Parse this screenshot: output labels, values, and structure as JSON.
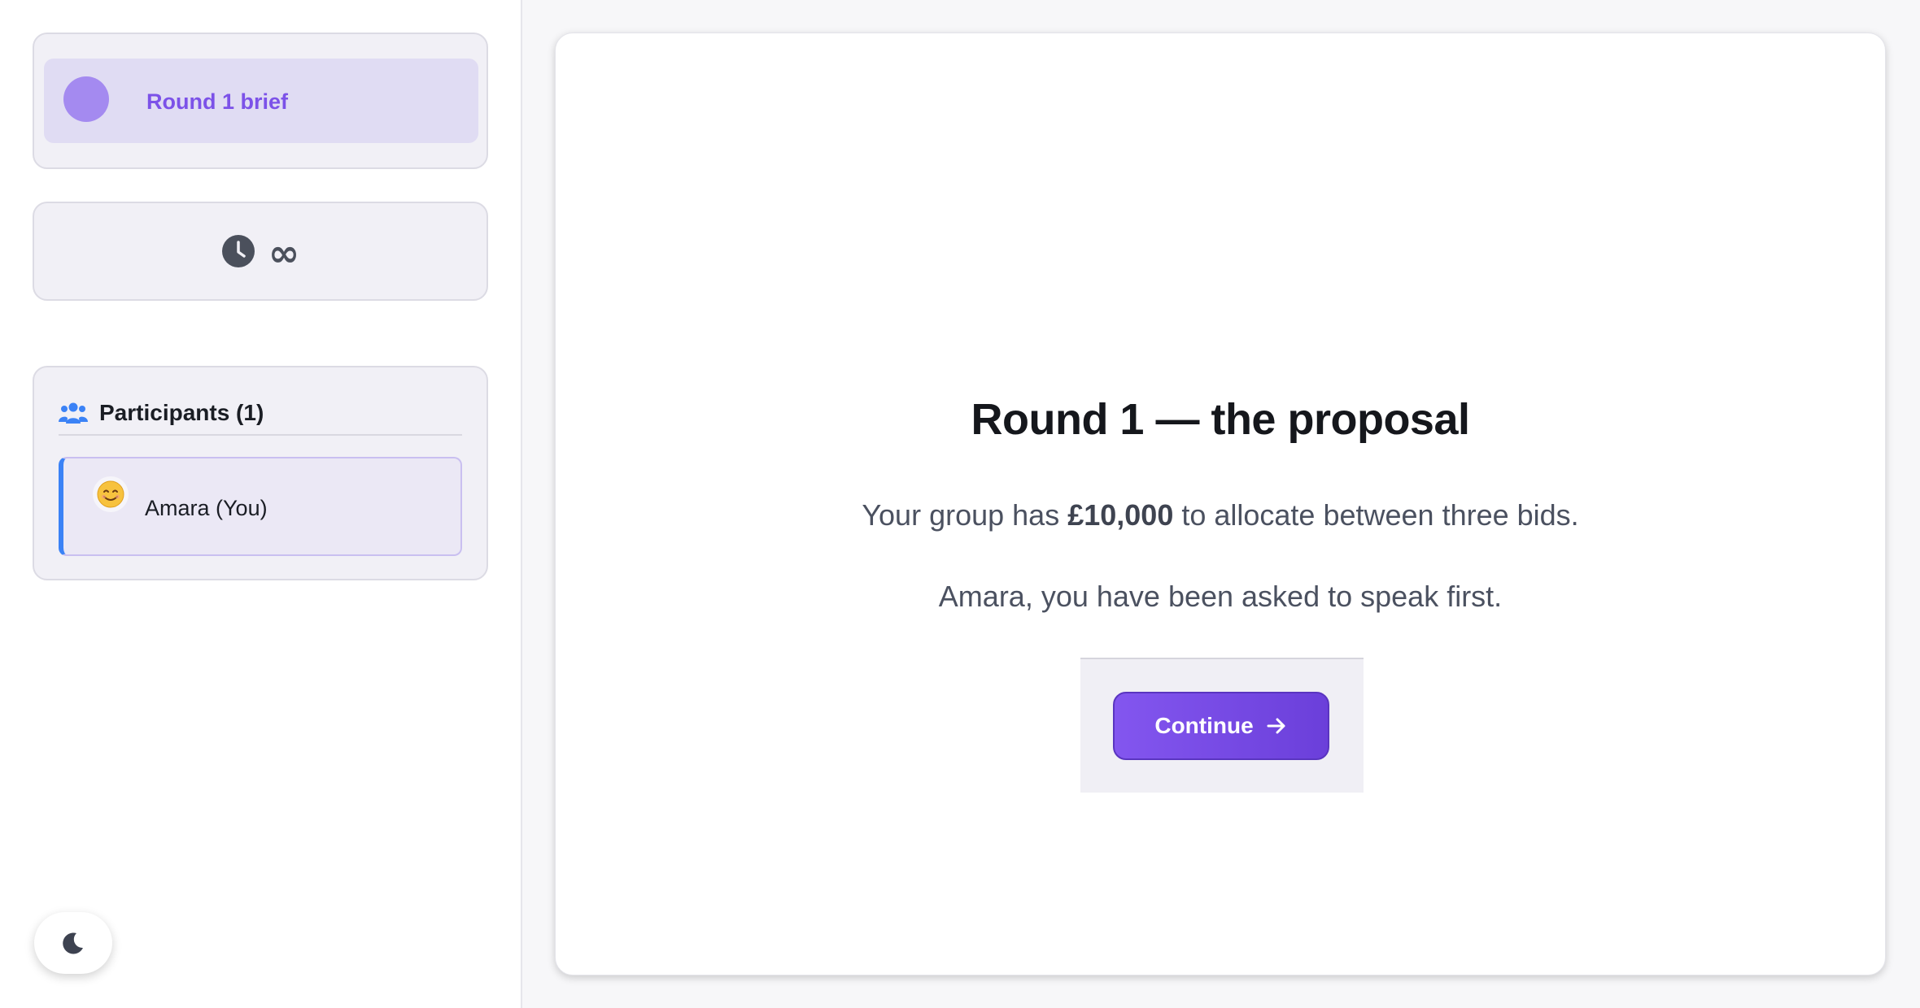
{
  "sidebar": {
    "brief": {
      "label": "Round 1 brief"
    },
    "timer": {
      "value": "∞",
      "icon": "clock-icon"
    },
    "participants": {
      "title": "Participants (1)",
      "icon": "users-icon",
      "items": [
        {
          "name": "Amara (You)",
          "avatar": "😊"
        }
      ]
    },
    "theme_toggle": {
      "icon": "moon-icon"
    }
  },
  "main": {
    "headline": "Round 1 — the proposal",
    "line1_prefix": "Your group has ",
    "line1_amount": "£10,000",
    "line1_suffix": " to allocate between three bids.",
    "line2": "Amara, you have been asked to speak first.",
    "continue_label": "Continue",
    "continue_icon": "arrow-right-icon"
  },
  "colors": {
    "accent": "#7c52e8",
    "button": "#6b3fda",
    "participant_border": "#3b82f6",
    "avatar_dot": "#a48af0"
  }
}
